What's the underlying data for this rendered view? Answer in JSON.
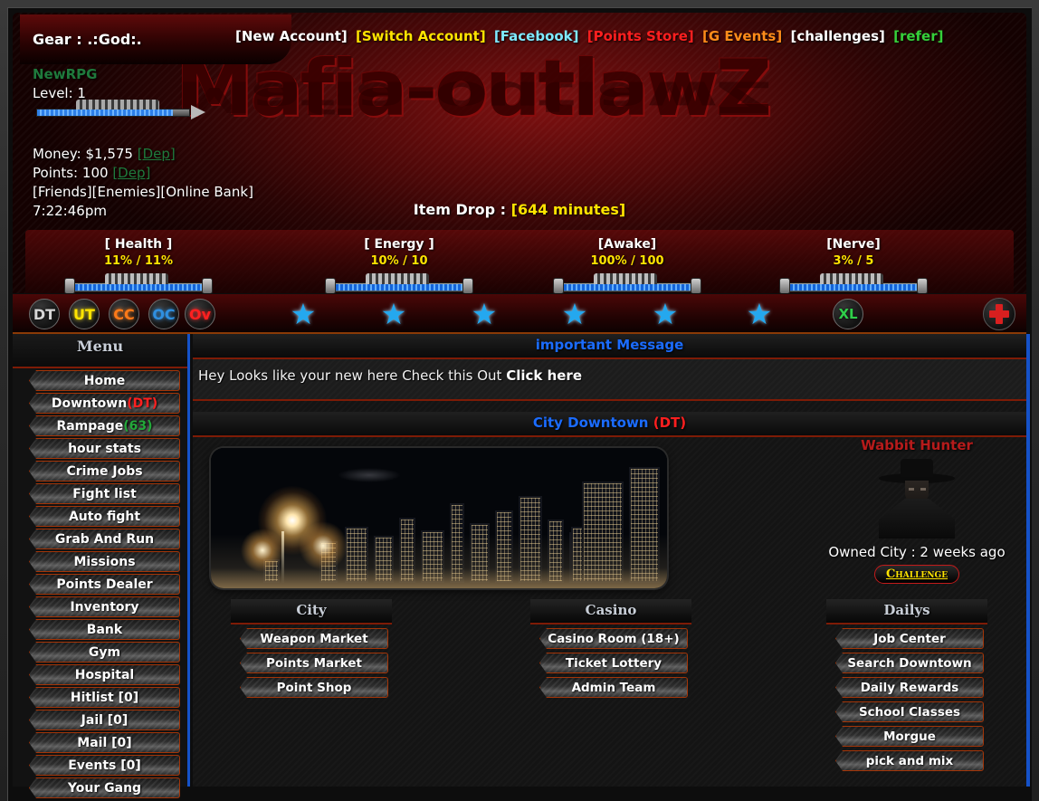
{
  "header": {
    "gear_label": "Gear : .:God:.",
    "banner_title": "Mafia-outlawZ",
    "username": "NewRPG",
    "level_label": "Level: 1",
    "money_label": "Money:",
    "money_value": "$1,575",
    "money_dep": "[Dep]",
    "points_label": "Points:",
    "points_value": "100",
    "points_dep": "[Dep]",
    "quick_links": "[Friends][Enemies][Online Bank]",
    "clock": "7:22:46pm",
    "item_drop_label": "Item Drop :",
    "item_drop_value": "[644 minutes]",
    "xp_percent": 88
  },
  "topnav": [
    {
      "label": "[New Account]",
      "color": "c-white"
    },
    {
      "label": "[Switch Account]",
      "color": "c-yellow"
    },
    {
      "label": "[Facebook]",
      "color": "c-cyan"
    },
    {
      "label": "[Points Store]",
      "color": "c-red"
    },
    {
      "label": "[G Events]",
      "color": "c-orange"
    },
    {
      "label": "[challenges]",
      "color": "c-white"
    },
    {
      "label": "[refer]",
      "color": "c-green"
    }
  ],
  "stats": [
    {
      "name": "[ Health ]",
      "value": "11% / 11%",
      "fill": 88
    },
    {
      "name": "[ Energy ]",
      "value": "10% / 10",
      "fill": 88
    },
    {
      "name": "[Awake]",
      "value": "100% / 100",
      "fill": 88
    },
    {
      "name": "[Nerve]",
      "value": "3% / 5",
      "fill": 88
    }
  ],
  "iconbar": {
    "buttons": [
      {
        "label": "DT",
        "color": "#d7d7d7",
        "shadow": "none"
      },
      {
        "label": "UT",
        "color": "#ffe400",
        "shadow": "#ffe400"
      },
      {
        "label": "CC",
        "color": "#ff7a18",
        "shadow": "#ff7a18"
      },
      {
        "label": "OC",
        "color": "#2f8fe0",
        "shadow": "#2f8fe0"
      },
      {
        "label": "Ov",
        "color": "#ff2020",
        "shadow": "#ff2020"
      }
    ],
    "star_count": 6,
    "star_glyph": "★",
    "xl_label": "XL",
    "medic_icon": "red-cross-icon"
  },
  "sidebar": {
    "title": "Menu",
    "items": [
      {
        "label": "Home"
      },
      {
        "label": "Downtown ",
        "suffix": "(DT)",
        "suffix_class": "sfx-red"
      },
      {
        "label": "Rampage ",
        "suffix": "(63)",
        "suffix_class": "sfx-green"
      },
      {
        "label": "hour stats"
      },
      {
        "label": "Crime Jobs"
      },
      {
        "label": "Fight list"
      },
      {
        "label": "Auto fight"
      },
      {
        "label": "Grab And Run"
      },
      {
        "label": "Missions"
      },
      {
        "label": "Points Dealer"
      },
      {
        "label": "Inventory"
      },
      {
        "label": "Bank"
      },
      {
        "label": "Gym"
      },
      {
        "label": "Hospital"
      },
      {
        "label": "Hitlist [0]"
      },
      {
        "label": "Jail [0]"
      },
      {
        "label": "Mail [0]"
      },
      {
        "label": "Events [0]"
      },
      {
        "label": "Your Gang"
      }
    ]
  },
  "main": {
    "message_panel": {
      "title": "important Message",
      "body_text": "Hey Looks like your new here Check this Out ",
      "body_link": "Click here"
    },
    "city_panel": {
      "title": "City Downtown ",
      "title_tag": "(DT)",
      "image_alt": "city-skyline-fireworks"
    },
    "wabbit": {
      "name": "Wabbit Hunter",
      "owned_label": "Owned City : 2 weeks ago",
      "challenge_label": "Challenge"
    },
    "columns": [
      {
        "title": "City",
        "items": [
          "Weapon Market",
          "Points Market",
          "Point Shop"
        ]
      },
      {
        "title": "Casino",
        "items": [
          "Casino Room (18+)",
          "Ticket Lottery",
          "Admin Team"
        ]
      },
      {
        "title": "Dailys",
        "items": [
          "Job Center",
          "Search Downtown",
          "Daily Rewards",
          "School Classes",
          "Morgue",
          "pick and mix"
        ]
      }
    ]
  },
  "colors": {
    "accent_red": "#a33508",
    "link_blue": "#1b6cff",
    "scroll_blue": "#1552c9",
    "star_blue": "#24a8ef",
    "yellow": "#ffe400"
  }
}
